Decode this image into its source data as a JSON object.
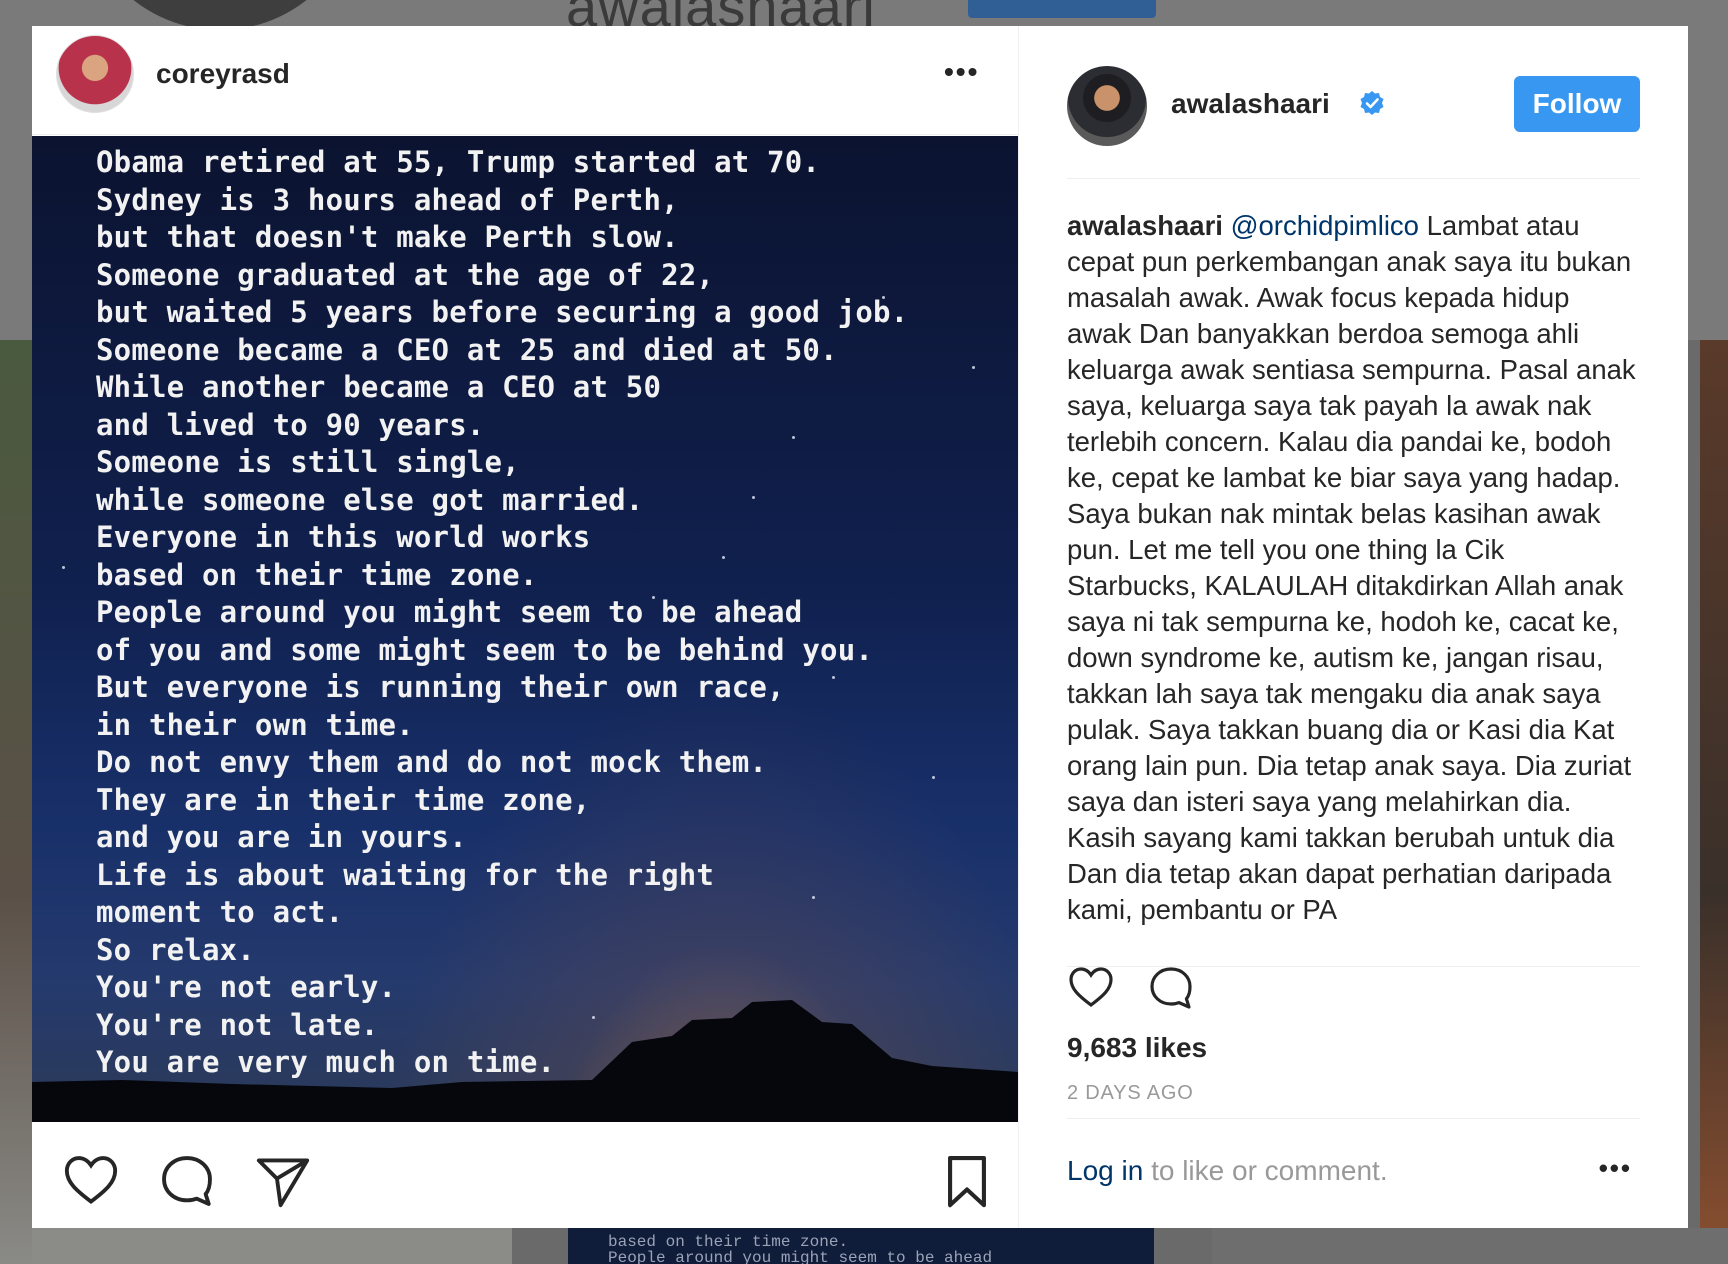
{
  "background": {
    "profile_name": "awalashaari",
    "tile_caption": "based on their time zone.\nPeople around you might seem to be ahead"
  },
  "post": {
    "author": {
      "username": "coreyrasd"
    },
    "more_icon": "ellipsis-icon",
    "image_text": "Obama retired at 55, Trump started at 70.\nSydney is 3 hours ahead of Perth,\nbut that doesn't make Perth slow.\nSomeone graduated at the age of 22,\nbut waited 5 years before securing a good job.\nSomeone became a CEO at 25 and died at 50.\nWhile another became a CEO at 50\nand lived to 90 years.\nSomeone is still single,\nwhile someone else got married.\nEveryone in this world works\nbased on their time zone.\nPeople around you might seem to be ahead\nof you and some might seem to be behind you.\nBut everyone is running their own race,\nin their own time.\nDo not envy them and do not mock them.\nThey are in their time zone,\nand you are in yours.\nLife is about waiting for the right\nmoment to act.\nSo relax.\nYou're not early.\nYou're not late.\nYou are very much on time.",
    "actions": [
      "heart-icon",
      "comment-icon",
      "share-icon",
      "bookmark-icon"
    ]
  },
  "sidebar": {
    "username": "awalashaari",
    "verified_icon": "verified-badge-icon",
    "follow_label": "Follow",
    "caption": {
      "username": "awalashaari",
      "mention": "@orchidpimlico",
      "text": " Lambat atau cepat pun perkembangan anak saya itu bukan masalah awak. Awak focus kepada hidup awak Dan banyakkan berdoa semoga ahli keluarga awak sentiasa sempurna. Pasal anak saya, keluarga saya tak payah la awak nak terlebih concern. Kalau dia pandai ke, bodoh ke, cepat ke lambat ke biar saya yang hadap. Saya bukan nak mintak belas kasihan awak pun. Let me tell you one thing la Cik Starbucks, KALAULAH ditakdirkan Allah anak saya ni tak sempurna ke, hodoh ke, cacat ke, down syndrome ke, autism ke, jangan risau, takkan lah saya tak mengaku dia anak saya pulak. Saya takkan buang dia or Kasi dia Kat orang lain pun. Dia tetap anak saya. Dia zuriat saya dan isteri saya yang melahirkan dia. Kasih sayang kami takkan berubah untuk dia Dan dia tetap akan dapat perhatian daripada kami, pembantu or PA"
    },
    "likes": "9,683 likes",
    "timestamp": "2 DAYS AGO",
    "login_link": "Log in",
    "login_rest": " to like or comment.",
    "colors": {
      "follow": "#3897f0",
      "link": "#003569",
      "muted": "#999999"
    }
  }
}
